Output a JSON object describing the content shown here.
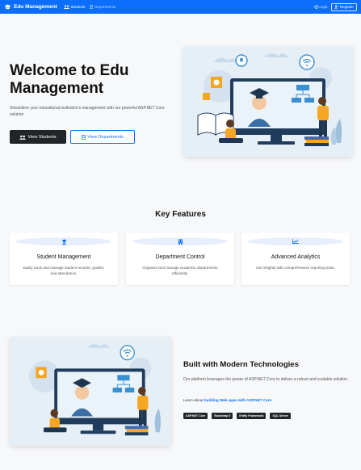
{
  "nav": {
    "brand": "Edu Management",
    "links": [
      "Students",
      "Departments"
    ],
    "login": "Login",
    "register": "Register"
  },
  "hero": {
    "title": "Welcome to Edu Management",
    "subtitle": "Streamline your educational institution's management with our powerful ASP.NET Core solution",
    "btn_students": "View Students",
    "btn_departments": "View Departments"
  },
  "features": {
    "title": "Key Features",
    "cards": [
      {
        "title": "Student Management",
        "desc": "Easily track and manage student records, grades, and attendance.",
        "icon": "user-graduate-icon"
      },
      {
        "title": "Department Control",
        "desc": "Organize and manage academic departments efficiently.",
        "icon": "building-icon"
      },
      {
        "title": "Advanced Analytics",
        "desc": "Get insights with comprehensive reporting tools.",
        "icon": "chart-line-icon"
      }
    ]
  },
  "tech": {
    "title": "Built with Modern Technologies",
    "subtitle": "Our platform leverages the power of ASP.NET Core to deliver a robust and scalable solution.",
    "learn_prefix": "Learn about",
    "learn_link": "building Web apps with ASP.NET Core",
    "badges": [
      "ASP.NET Core",
      "Bootstrap 5",
      "Entity Framework",
      "SQL Server"
    ]
  },
  "colors": {
    "primary": "#0d6efd",
    "dark": "#212529",
    "background": "#f7f8fa",
    "accent": "#f5a623"
  }
}
